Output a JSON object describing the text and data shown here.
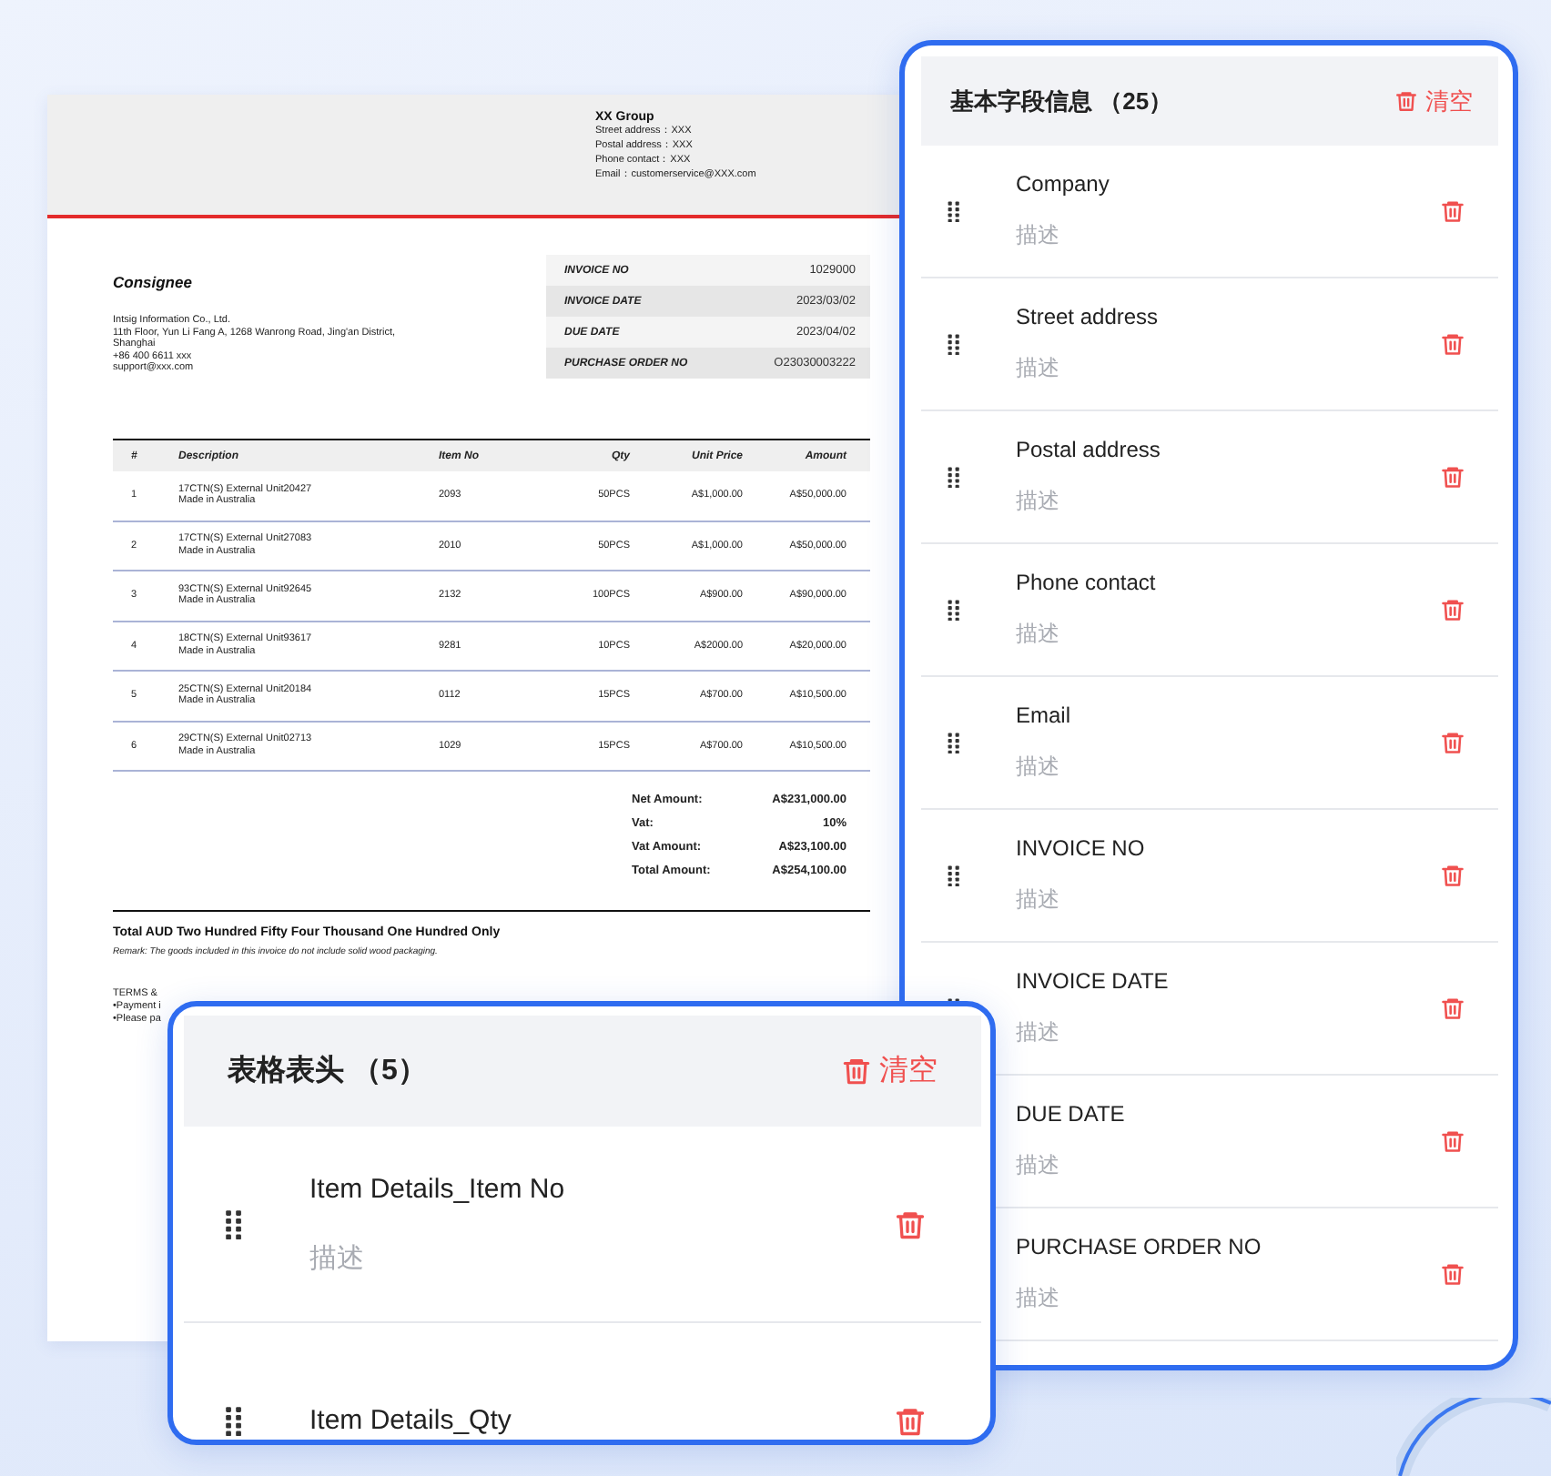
{
  "invoice": {
    "company": {
      "name": "XX Group",
      "lines": [
        "Street address：XXX",
        "Postal address：XXX",
        "Phone contact：XXX",
        "Email：customerservice@XXX.com"
      ]
    },
    "consignee": {
      "title": "Consignee",
      "lines": [
        "Intsig Information Co., Ltd.",
        "11th Floor, Yun Li Fang A, 1268 Wanrong Road, Jing'an District, Shanghai",
        "+86 400 6611 xxx",
        "support@xxx.com"
      ]
    },
    "meta": [
      {
        "label": "INVOICE NO",
        "value": "1029000"
      },
      {
        "label": "INVOICE DATE",
        "value": "2023/03/02"
      },
      {
        "label": "DUE DATE",
        "value": "2023/04/02"
      },
      {
        "label": "PURCHASE ORDER NO",
        "value": "O23030003222"
      }
    ],
    "columns": [
      "#",
      "Description",
      "Item No",
      "Qty",
      "Unit Price",
      "Amount"
    ],
    "rows": [
      {
        "no": "1",
        "description": "17CTN(S) External Unit20427",
        "origin": "Made in Australia",
        "item_no": "2093",
        "qty": "50PCS",
        "unit_price": "A$1,000.00",
        "amount": "A$50,000.00"
      },
      {
        "no": "2",
        "description": "17CTN(S) External Unit27083",
        "origin": "Made in Australia",
        "item_no": "2010",
        "qty": "50PCS",
        "unit_price": "A$1,000.00",
        "amount": "A$50,000.00"
      },
      {
        "no": "3",
        "description": "93CTN(S) External Unit92645",
        "origin": "Made in Australia",
        "item_no": "2132",
        "qty": "100PCS",
        "unit_price": "A$900.00",
        "amount": "A$90,000.00"
      },
      {
        "no": "4",
        "description": "18CTN(S) External Unit93617",
        "origin": "Made in Australia",
        "item_no": "9281",
        "qty": "10PCS",
        "unit_price": "A$2000.00",
        "amount": "A$20,000.00"
      },
      {
        "no": "5",
        "description": "25CTN(S) External Unit20184",
        "origin": "Made in Australia",
        "item_no": "0112",
        "qty": "15PCS",
        "unit_price": "A$700.00",
        "amount": "A$10,500.00"
      },
      {
        "no": "6",
        "description": "29CTN(S) External Unit02713",
        "origin": "Made in Australia",
        "item_no": "1029",
        "qty": "15PCS",
        "unit_price": "A$700.00",
        "amount": "A$10,500.00"
      }
    ],
    "totals": [
      {
        "label": "Net Amount:",
        "value": "A$231,000.00"
      },
      {
        "label": "Vat:",
        "value": "10%"
      },
      {
        "label": "Vat Amount:",
        "value": "A$23,100.00"
      },
      {
        "label": "Total Amount:",
        "value": "A$254,100.00"
      }
    ],
    "amount_in_words": "Total AUD Two Hundred Fifty Four Thousand One Hundred Only",
    "remark": "Remark: The goods included in this invoice do not include solid wood packaging.",
    "terms": [
      "TERMS &",
      "•Payment i",
      "•Please pa"
    ]
  },
  "field_panel": {
    "title": "基本字段信息 （25）",
    "clear_label": "清空",
    "fields": [
      {
        "name": "Company",
        "description": "描述"
      },
      {
        "name": "Street address",
        "description": "描述"
      },
      {
        "name": "Postal address",
        "description": "描述"
      },
      {
        "name": "Phone contact",
        "description": "描述"
      },
      {
        "name": "Email",
        "description": "描述"
      },
      {
        "name": "INVOICE NO",
        "description": "描述"
      },
      {
        "name": "INVOICE DATE",
        "description": "描述"
      },
      {
        "name": "DUE DATE",
        "description": "描述"
      },
      {
        "name": "PURCHASE ORDER NO",
        "description": "描述"
      }
    ]
  },
  "table_header_panel": {
    "title": "表格表头 （5）",
    "clear_label": "清空",
    "fields": [
      {
        "name": "Item Details_Item No",
        "description": "描述"
      },
      {
        "name": "Item Details_Qty"
      }
    ]
  }
}
